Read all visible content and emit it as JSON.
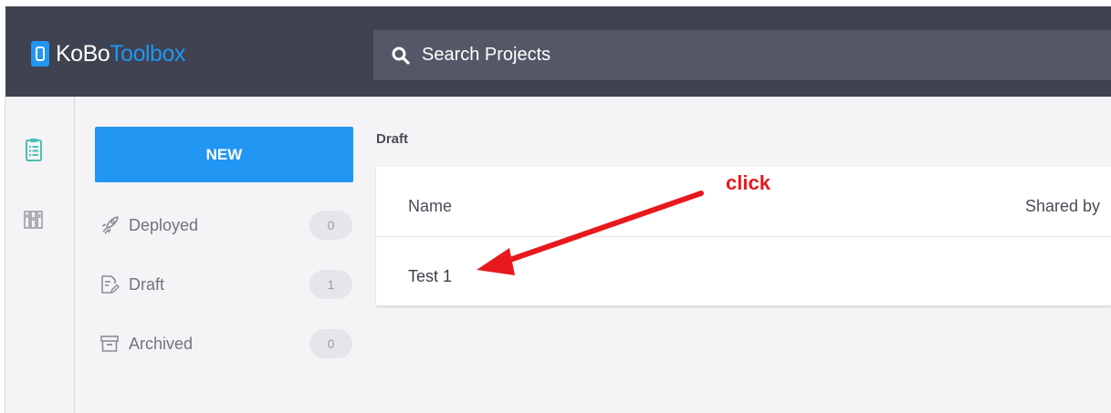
{
  "header": {
    "logo": {
      "part1": "KoBo",
      "part2": "Toolbox"
    },
    "search": {
      "placeholder": "Search Projects",
      "icon": "search-icon"
    }
  },
  "rail": {
    "items": [
      {
        "icon": "clipboard-icon",
        "active": true
      },
      {
        "icon": "library-icon",
        "active": false
      }
    ]
  },
  "sidebar": {
    "new_button": "NEW",
    "items": [
      {
        "label": "Deployed",
        "count": "0",
        "icon": "rocket-icon"
      },
      {
        "label": "Draft",
        "count": "1",
        "icon": "draft-icon"
      },
      {
        "label": "Archived",
        "count": "0",
        "icon": "archive-icon"
      }
    ]
  },
  "main": {
    "section_title": "Draft",
    "columns": {
      "name": "Name",
      "shared_by": "Shared by"
    },
    "rows": [
      {
        "name": "Test 1"
      }
    ]
  },
  "annotation": {
    "text": "click",
    "color": "#e8191d"
  },
  "colors": {
    "header_bg": "#3f4250",
    "search_bg": "#545766",
    "accent": "#2196f3",
    "panel_bg": "#f4f4f6",
    "rail_active": "#4bbfb0"
  }
}
